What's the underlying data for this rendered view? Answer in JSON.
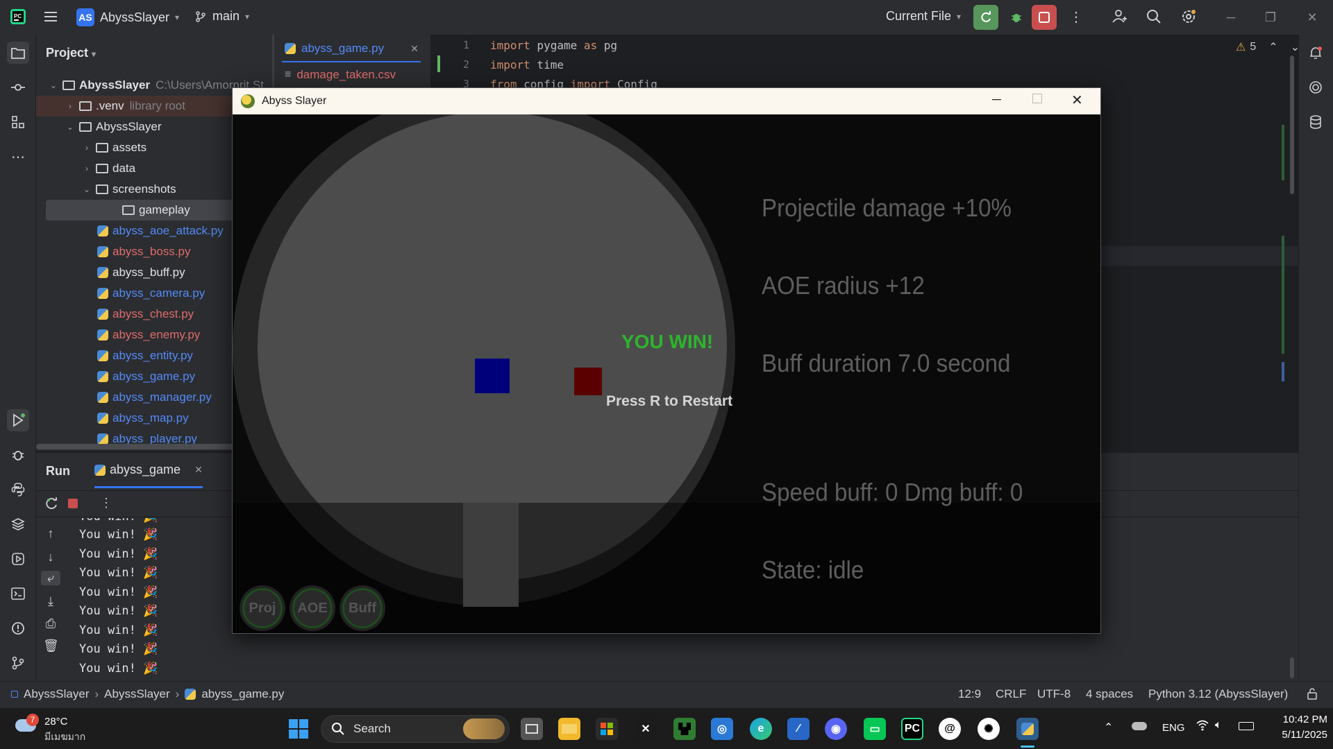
{
  "ide": {
    "project_initials": "AS",
    "project_name": "AbyssSlayer",
    "branch": "main",
    "run_config": "Current File",
    "warnings_count": "5"
  },
  "project_panel": {
    "title": "Project",
    "tree": [
      {
        "label": "AbyssSlayer",
        "extra": "C:\\Users\\Amornrit St",
        "kind": "folder",
        "style": "plain"
      },
      {
        "label": ".venv",
        "extra": "library root",
        "kind": "folder",
        "style": "plain"
      },
      {
        "label": "AbyssSlayer",
        "extra": "",
        "kind": "folder",
        "style": "plain"
      },
      {
        "label": "assets",
        "extra": "",
        "kind": "folder",
        "style": "plain"
      },
      {
        "label": "data",
        "extra": "",
        "kind": "folder",
        "style": "plain"
      },
      {
        "label": "screenshots",
        "extra": "",
        "kind": "folder",
        "style": "plain"
      },
      {
        "label": "gameplay",
        "extra": "",
        "kind": "folder",
        "style": "plain"
      },
      {
        "label": "abyss_aoe_attack.py",
        "kind": "py",
        "style": "blue"
      },
      {
        "label": "abyss_boss.py",
        "kind": "py",
        "style": "red"
      },
      {
        "label": "abyss_buff.py",
        "kind": "py",
        "style": "plain"
      },
      {
        "label": "abyss_camera.py",
        "kind": "py",
        "style": "blue"
      },
      {
        "label": "abyss_chest.py",
        "kind": "py",
        "style": "red"
      },
      {
        "label": "abyss_enemy.py",
        "kind": "py",
        "style": "red"
      },
      {
        "label": "abyss_entity.py",
        "kind": "py",
        "style": "blue"
      },
      {
        "label": "abyss_game.py",
        "kind": "py",
        "style": "blue"
      },
      {
        "label": "abyss_manager.py",
        "kind": "py",
        "style": "blue"
      },
      {
        "label": "abyss_map.py",
        "kind": "py",
        "style": "blue"
      },
      {
        "label": "abyss_player.py",
        "kind": "py",
        "style": "blue"
      }
    ]
  },
  "editor": {
    "tabs": [
      {
        "label": "abyss_game.py"
      },
      {
        "label": "damage_taken.csv"
      }
    ],
    "lines": [
      {
        "num": "1",
        "kw1": "import",
        "rest": " pygame ",
        "kw2": "as",
        "rest2": " pg"
      },
      {
        "num": "2",
        "kw1": "import",
        "rest": " time",
        "kw2": "",
        "rest2": ""
      },
      {
        "num": "3",
        "kw1": "from",
        "rest": " config ",
        "kw2": "import",
        "rest2": " Config"
      }
    ]
  },
  "run_panel": {
    "title": "Run",
    "tab": "abyss_game",
    "partial_line": "You win! 🎉",
    "output": [
      "You win! 🎉",
      "You win! 🎉",
      "You win! 🎉",
      "You win! 🎉",
      "You win! 🎉",
      "You win! 🎉",
      "You win! 🎉",
      "You win! 🎉"
    ]
  },
  "game": {
    "window_title": "Abyss Slayer",
    "win_text": "YOU WIN!",
    "restart_text": "Press R to Restart",
    "stats": {
      "line1": "Projectile damage +10%",
      "line2": "AOE radius +12",
      "line3": "Buff duration 7.0 second",
      "line4": "Speed buff: 0 Dmg buff: 0",
      "line5": "State: idle"
    },
    "skills": [
      "Proj",
      "AOE",
      "Buff"
    ],
    "colors": {
      "win": "#2db52d",
      "player": "#00007a",
      "enemy": "#5a0000"
    }
  },
  "statusbar": {
    "crumbs": [
      "AbyssSlayer",
      "AbyssSlayer",
      "abyss_game.py"
    ],
    "position": "12:9",
    "line_sep": "CRLF",
    "encoding": "UTF-8",
    "indent": "4 spaces",
    "interpreter": "Python 3.12 (AbyssSlayer)"
  },
  "taskbar": {
    "weather_badge": "7",
    "temp": "28°C",
    "weather_desc": "มีเมฆมาก",
    "search": "Search",
    "lang": "ENG",
    "time": "10:42 PM",
    "date": "5/11/2025"
  }
}
